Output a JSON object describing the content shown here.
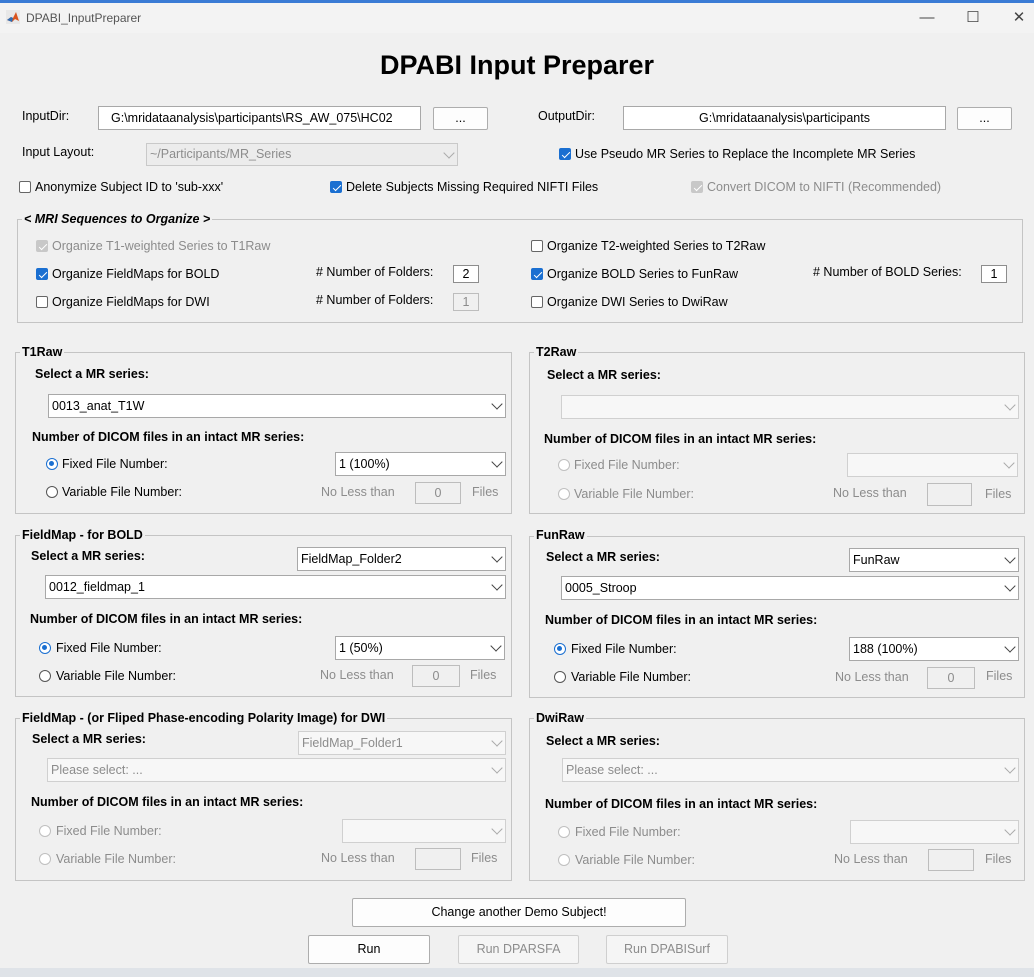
{
  "window": {
    "title": "DPABI_InputPreparer",
    "minimize": "—",
    "maximize": "☐",
    "close": "✕"
  },
  "heading": "DPABI Input Preparer",
  "io": {
    "input_dir_label": "InputDir:",
    "input_dir_value": "G:\\mridataanalysis\\participants\\RS_AW_075\\HC02",
    "input_browse": "...",
    "output_dir_label": "OutputDir:",
    "output_dir_value": "G:\\mridataanalysis\\participants",
    "output_browse": "...",
    "layout_label": "Input Layout:",
    "layout_value": "~/Participants/MR_Series"
  },
  "options": {
    "pseudo_series": "Use Pseudo MR Series to Replace the Incomplete MR Series",
    "anonymize": "Anonymize Subject ID to 'sub-xxx'",
    "delete_missing": "Delete Subjects Missing Required NIFTI Files",
    "convert_dicom": "Convert DICOM to NIFTI (Recommended)"
  },
  "sequences": {
    "title": "< MRI Sequences to Organize >",
    "t1": "Organize T1-weighted Series to T1Raw",
    "t2": "Organize T2-weighted Series to T2Raw",
    "fm_bold": "Organize FieldMaps for BOLD",
    "fm_bold_folders_label": "# Number of Folders:",
    "fm_bold_folders": "2",
    "bold": "Organize BOLD Series to FunRaw",
    "bold_series_label": "# Number of BOLD Series:",
    "bold_series": "1",
    "fm_dwi": "Organize FieldMaps for DWI",
    "fm_dwi_folders_label": "# Number of Folders:",
    "fm_dwi_folders": "1",
    "dwi": "Organize DWI Series to DwiRaw"
  },
  "common": {
    "select_series": "Select a MR series:",
    "dicom_count": "Number of DICOM files in an intact MR series:",
    "fixed": "Fixed File Number:",
    "variable": "Variable File Number:",
    "no_less": "No Less than",
    "files": "Files"
  },
  "t1raw": {
    "title": "T1Raw",
    "series": "0013_anat_T1W",
    "fixed_value": "1 (100%)",
    "min_files": "0"
  },
  "t2raw": {
    "title": "T2Raw",
    "series": "",
    "fixed_value": "",
    "min_files": ""
  },
  "fm_bold_panel": {
    "title": "FieldMap - for BOLD",
    "folder": "FieldMap_Folder2",
    "series": "0012_fieldmap_1",
    "fixed_value": "1 (50%)",
    "min_files": "0"
  },
  "funraw": {
    "title": "FunRaw",
    "folder": "FunRaw",
    "series": "0005_Stroop",
    "fixed_value": "188 (100%)",
    "min_files": "0"
  },
  "fm_dwi_panel": {
    "title": "FieldMap - (or Fliped Phase-encoding Polarity Image) for DWI",
    "folder": "FieldMap_Folder1",
    "series": "Please select: ...",
    "fixed_value": "",
    "min_files": ""
  },
  "dwiraw": {
    "title": "DwiRaw",
    "series": "Please select: ...",
    "fixed_value": "",
    "min_files": ""
  },
  "actions": {
    "change_subject": "Change another Demo Subject!",
    "run": "Run",
    "run_dparsfa": "Run DPARSFA",
    "run_dpabisurf": "Run DPABISurf"
  },
  "colors": {
    "accent": "#1a6fd1",
    "background": "#f0f0f0"
  }
}
